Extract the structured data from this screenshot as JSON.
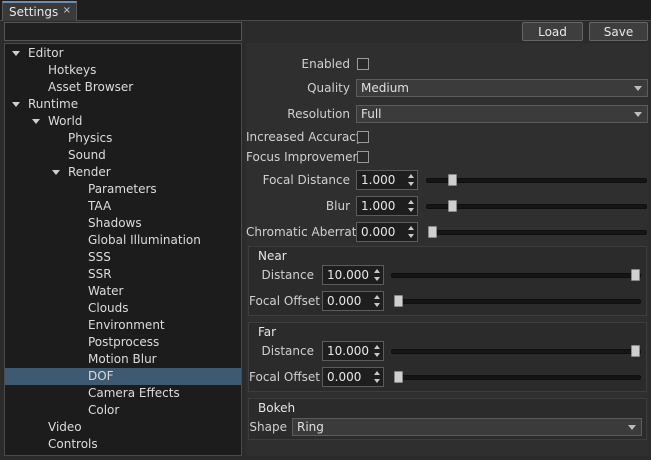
{
  "tab": {
    "title": "Settings",
    "close": "×"
  },
  "buttons": {
    "load": "Load",
    "save": "Save"
  },
  "tree": [
    {
      "label": "Editor",
      "arrow": true
    },
    {
      "label": "Hotkeys"
    },
    {
      "label": "Asset Browser"
    },
    {
      "label": "Runtime",
      "arrow": true
    },
    {
      "label": "World",
      "arrow": true
    },
    {
      "label": "Physics"
    },
    {
      "label": "Sound"
    },
    {
      "label": "Render",
      "arrow": true
    },
    {
      "label": "Parameters"
    },
    {
      "label": "TAA"
    },
    {
      "label": "Shadows"
    },
    {
      "label": "Global Illumination"
    },
    {
      "label": "SSS"
    },
    {
      "label": "SSR"
    },
    {
      "label": "Water"
    },
    {
      "label": "Clouds"
    },
    {
      "label": "Environment"
    },
    {
      "label": "Postprocess"
    },
    {
      "label": "Motion Blur"
    },
    {
      "label": "DOF",
      "selected": true
    },
    {
      "label": "Camera Effects"
    },
    {
      "label": "Color"
    },
    {
      "label": "Video"
    },
    {
      "label": "Controls"
    }
  ],
  "form": {
    "enabled_label": "Enabled",
    "quality_label": "Quality",
    "quality_value": "Medium",
    "resolution_label": "Resolution",
    "resolution_value": "Full",
    "accuracy_label": "Increased Accuracy",
    "focus_label": "Focus Improvement",
    "focal_distance_label": "Focal Distance",
    "focal_distance_value": "1.000",
    "blur_label": "Blur",
    "blur_value": "1.000",
    "chromatic_label": "Chromatic Aberration",
    "chromatic_value": "0.000"
  },
  "near": {
    "title": "Near",
    "distance_label": "Distance",
    "distance_value": "10.000",
    "offset_label": "Focal Offset",
    "offset_value": "0.000"
  },
  "far": {
    "title": "Far",
    "distance_label": "Distance",
    "distance_value": "10.000",
    "offset_label": "Focal Offset",
    "offset_value": "0.000"
  },
  "bokeh": {
    "title": "Bokeh",
    "shape_label": "Shape",
    "shape_value": "Ring"
  }
}
